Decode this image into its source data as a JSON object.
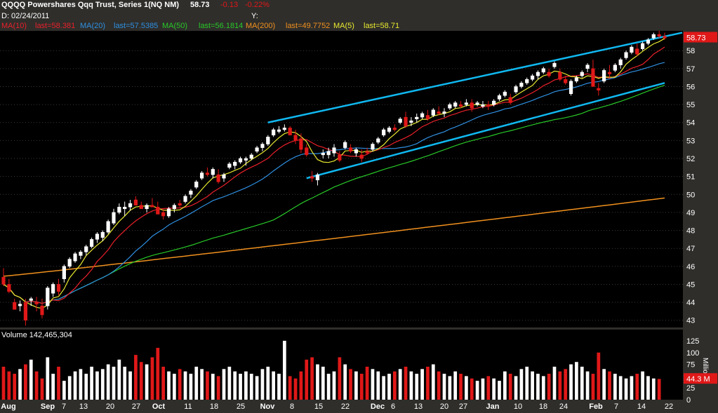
{
  "header": {
    "symbol_title": "QQQQ Powershares Qqq Trust, Series 1(NQ NM)",
    "last": "58.73",
    "change": "-0.13",
    "change_pct": "-0.22%",
    "date_line": "D: 02/24/2011",
    "y_label": "Y:",
    "legend": [
      {
        "label": "MA(10)",
        "last": "last=58.381",
        "color": "#e8202a"
      },
      {
        "label": "MA(20)",
        "last": "last=57.5385",
        "color": "#2f8fe0"
      },
      {
        "label": "MA(50)",
        "last": "last=56.1814",
        "color": "#28c828"
      },
      {
        "label": "MA(200)",
        "last": "last=49.7752",
        "color": "#f0901e"
      },
      {
        "label": "MA(5)",
        "last": "last=58.71",
        "color": "#e8e830"
      }
    ]
  },
  "volume_panel": {
    "label": "Volume 142,465,304",
    "unit": "Millions",
    "last_badge": "44.3 M"
  },
  "chart_data": {
    "type": "candlestick",
    "price_axis": {
      "ticks": [
        43,
        44,
        45,
        46,
        47,
        48,
        49,
        50,
        51,
        52,
        53,
        54,
        55,
        56,
        57,
        58
      ],
      "last_badge": "58.73",
      "range": [
        42.6,
        59.1
      ]
    },
    "volume_axis": {
      "ticks": [
        0,
        25,
        50,
        75,
        100,
        125
      ],
      "range": [
        0,
        125
      ],
      "unit": "Millions"
    },
    "x_labels": [
      "Aug",
      "Sep",
      "7",
      "13",
      "20",
      "27",
      "Oct",
      "11",
      "18",
      "25",
      "Nov",
      "8",
      "15",
      "22",
      "Dec",
      "6",
      "13",
      "20",
      "27",
      "Jan",
      "10",
      "18",
      "24",
      "Feb",
      "7",
      "14",
      "22"
    ],
    "colors": {
      "up": "#ffffff",
      "down": "#e01818",
      "ma5": "#e8e830",
      "ma10": "#e8202a",
      "ma20": "#2f8fe0",
      "ma50": "#28c828",
      "ma200": "#f0901e",
      "channel": "#10b8f0",
      "grid": "#3a3a3a"
    },
    "trend_channel": {
      "upper": [
        [
          54.0,
          58.35
        ],
        [
          58.7,
          59.0
        ]
      ],
      "lower": [
        [
          51.5,
          56.2
        ],
        [
          50.9,
          55.5
        ]
      ]
    },
    "candles_ohlc": [
      [
        45.4,
        45.9,
        44.9,
        45.0
      ],
      [
        45.0,
        45.3,
        44.5,
        44.6
      ],
      [
        44.0,
        44.2,
        43.7,
        43.6
      ],
      [
        43.8,
        44.1,
        43.5,
        43.9
      ],
      [
        44.0,
        44.2,
        42.7,
        43.0
      ],
      [
        44.1,
        44.3,
        43.8,
        44.2
      ],
      [
        44.0,
        44.3,
        43.5,
        43.9
      ],
      [
        43.8,
        44.2,
        43.1,
        43.3
      ],
      [
        43.8,
        44.9,
        43.6,
        44.8
      ],
      [
        44.5,
        45.1,
        44.3,
        45.0
      ],
      [
        45.0,
        45.3,
        44.4,
        44.6
      ],
      [
        45.3,
        46.1,
        45.1,
        46.0
      ],
      [
        46.0,
        46.5,
        45.9,
        46.4
      ],
      [
        46.3,
        46.8,
        46.2,
        46.7
      ],
      [
        46.6,
        46.9,
        46.4,
        46.8
      ],
      [
        46.8,
        47.2,
        46.6,
        47.1
      ],
      [
        47.1,
        47.6,
        47.0,
        47.5
      ],
      [
        47.5,
        47.9,
        47.3,
        47.8
      ],
      [
        47.6,
        48.0,
        47.4,
        47.9
      ],
      [
        47.9,
        48.6,
        47.8,
        48.5
      ],
      [
        48.4,
        49.2,
        48.3,
        49.0
      ],
      [
        49.0,
        49.5,
        48.9,
        49.3
      ],
      [
        49.2,
        49.6,
        48.8,
        49.3
      ],
      [
        49.3,
        49.7,
        49.1,
        49.5
      ],
      [
        49.7,
        49.9,
        49.5,
        49.4
      ],
      [
        49.4,
        49.6,
        49.2,
        49.2
      ],
      [
        49.2,
        49.5,
        49.0,
        49.4
      ],
      [
        49.4,
        49.8,
        49.3,
        49.3
      ],
      [
        49.3,
        49.6,
        49.2,
        48.9
      ],
      [
        49.0,
        49.2,
        48.6,
        48.8
      ],
      [
        48.8,
        49.3,
        48.7,
        49.2
      ],
      [
        49.2,
        49.5,
        49.0,
        49.4
      ],
      [
        49.5,
        49.7,
        49.3,
        49.4
      ],
      [
        49.6,
        50.0,
        49.5,
        49.9
      ],
      [
        50.0,
        50.3,
        49.8,
        50.2
      ],
      [
        50.4,
        50.8,
        50.3,
        50.7
      ],
      [
        50.9,
        51.3,
        50.8,
        51.2
      ],
      [
        51.2,
        51.5,
        51.0,
        51.1
      ],
      [
        51.1,
        51.5,
        50.9,
        51.4
      ],
      [
        51.1,
        51.4,
        50.6,
        50.7
      ],
      [
        50.9,
        51.2,
        50.7,
        51.1
      ],
      [
        51.5,
        51.8,
        51.4,
        51.7
      ],
      [
        51.6,
        51.9,
        51.4,
        51.8
      ],
      [
        51.8,
        52.1,
        51.7,
        52.0
      ],
      [
        51.9,
        52.1,
        51.6,
        52.0
      ],
      [
        52.0,
        52.3,
        51.9,
        52.2
      ],
      [
        52.4,
        52.7,
        52.3,
        52.6
      ],
      [
        52.6,
        52.9,
        52.4,
        52.8
      ],
      [
        52.8,
        53.3,
        52.7,
        53.2
      ],
      [
        53.3,
        53.7,
        53.2,
        53.6
      ],
      [
        53.5,
        53.8,
        53.4,
        53.6
      ],
      [
        53.6,
        53.9,
        53.5,
        53.7
      ],
      [
        53.7,
        53.8,
        53.5,
        53.3
      ],
      [
        53.3,
        53.6,
        52.8,
        53.0
      ],
      [
        53.1,
        53.4,
        52.3,
        52.5
      ],
      [
        52.6,
        52.8,
        52.1,
        52.2
      ],
      [
        51.0,
        51.3,
        50.7,
        50.9
      ],
      [
        50.8,
        51.2,
        50.5,
        51.1
      ],
      [
        52.2,
        52.5,
        52.0,
        52.3
      ],
      [
        52.2,
        52.6,
        52.0,
        52.4
      ],
      [
        52.3,
        52.8,
        52.1,
        52.6
      ],
      [
        52.2,
        52.4,
        51.8,
        51.9
      ],
      [
        52.6,
        53.0,
        52.5,
        52.9
      ],
      [
        52.6,
        52.8,
        52.3,
        52.4
      ],
      [
        52.3,
        52.6,
        52.1,
        52.5
      ],
      [
        52.2,
        52.5,
        51.8,
        52.0
      ],
      [
        52.4,
        52.6,
        52.2,
        52.3
      ],
      [
        52.5,
        52.9,
        52.4,
        52.8
      ],
      [
        52.9,
        53.2,
        52.8,
        53.1
      ],
      [
        53.3,
        53.7,
        53.2,
        53.6
      ],
      [
        53.5,
        53.8,
        53.4,
        53.7
      ],
      [
        53.7,
        53.9,
        53.5,
        53.6
      ],
      [
        54.0,
        54.3,
        53.9,
        54.2
      ],
      [
        54.3,
        54.6,
        53.7,
        53.8
      ],
      [
        54.0,
        54.3,
        53.8,
        54.1
      ],
      [
        54.2,
        54.5,
        54.0,
        54.3
      ],
      [
        54.3,
        54.6,
        54.2,
        54.5
      ],
      [
        54.4,
        54.7,
        54.1,
        54.2
      ],
      [
        54.4,
        54.8,
        54.3,
        54.7
      ],
      [
        54.6,
        54.9,
        54.4,
        54.5
      ],
      [
        54.5,
        54.8,
        54.3,
        54.6
      ],
      [
        54.8,
        55.1,
        54.7,
        55.0
      ],
      [
        54.9,
        55.2,
        54.8,
        55.1
      ],
      [
        55.0,
        55.2,
        54.8,
        54.9
      ],
      [
        55.0,
        55.3,
        54.9,
        55.1
      ],
      [
        55.1,
        55.3,
        54.6,
        54.8
      ],
      [
        55.0,
        55.2,
        54.9,
        55.1
      ],
      [
        54.9,
        55.2,
        54.8,
        55.0
      ],
      [
        55.0,
        55.2,
        54.7,
        54.9
      ],
      [
        55.0,
        55.3,
        54.9,
        55.2
      ],
      [
        55.3,
        55.6,
        55.2,
        55.5
      ],
      [
        55.5,
        55.8,
        55.4,
        55.7
      ],
      [
        55.4,
        55.6,
        55.0,
        55.1
      ],
      [
        55.7,
        56.1,
        55.6,
        56.0
      ],
      [
        56.0,
        56.3,
        55.9,
        56.2
      ],
      [
        56.2,
        56.5,
        56.1,
        56.4
      ],
      [
        56.4,
        56.7,
        56.3,
        56.6
      ],
      [
        56.6,
        56.9,
        56.4,
        56.8
      ],
      [
        56.8,
        57.1,
        56.7,
        57.0
      ],
      [
        56.8,
        57.0,
        56.5,
        56.6
      ],
      [
        57.1,
        57.4,
        57.0,
        57.3
      ],
      [
        56.8,
        57.0,
        56.3,
        56.4
      ],
      [
        56.4,
        56.6,
        56.1,
        56.2
      ],
      [
        55.6,
        56.4,
        55.5,
        56.3
      ],
      [
        56.3,
        56.6,
        56.2,
        56.5
      ],
      [
        56.6,
        56.9,
        56.5,
        56.8
      ],
      [
        57.0,
        57.3,
        56.8,
        57.2
      ],
      [
        57.0,
        57.5,
        56.8,
        56.0
      ],
      [
        55.9,
        56.2,
        55.5,
        55.8
      ],
      [
        56.3,
        57.0,
        56.2,
        56.9
      ],
      [
        56.8,
        57.2,
        56.5,
        56.7
      ],
      [
        56.9,
        57.3,
        56.8,
        57.2
      ],
      [
        57.2,
        57.6,
        57.0,
        57.5
      ],
      [
        57.6,
        58.0,
        57.5,
        57.9
      ],
      [
        57.9,
        58.3,
        57.8,
        58.2
      ],
      [
        58.1,
        58.4,
        57.7,
        57.8
      ],
      [
        58.1,
        58.5,
        58.0,
        58.4
      ],
      [
        58.4,
        58.7,
        58.3,
        58.6
      ],
      [
        58.7,
        59.0,
        58.6,
        58.9
      ],
      [
        58.9,
        59.1,
        58.7,
        58.8
      ],
      [
        58.8,
        59.0,
        58.6,
        58.7
      ]
    ],
    "volume_millions": [
      70,
      60,
      55,
      65,
      75,
      85,
      60,
      45,
      90,
      55,
      70,
      40,
      50,
      60,
      65,
      55,
      70,
      60,
      65,
      75,
      70,
      85,
      70,
      60,
      95,
      80,
      75,
      90,
      110,
      70,
      60,
      55,
      65,
      60,
      55,
      70,
      65,
      60,
      55,
      50,
      65,
      70,
      60,
      55,
      60,
      55,
      50,
      65,
      70,
      60,
      55,
      125,
      50,
      45,
      60,
      85,
      90,
      75,
      70,
      55,
      60,
      90,
      75,
      65,
      60,
      55,
      70,
      65,
      60,
      50,
      55,
      60,
      65,
      70,
      60,
      55,
      65,
      70,
      75,
      60,
      55,
      50,
      60,
      55,
      50,
      45,
      40,
      45,
      50,
      45,
      40,
      60,
      55,
      50,
      65,
      70,
      60,
      55,
      50,
      55,
      70,
      60,
      65,
      75,
      80,
      70,
      60,
      55,
      100,
      65,
      60,
      55,
      50,
      45,
      50,
      55,
      60,
      50,
      45,
      44
    ]
  }
}
